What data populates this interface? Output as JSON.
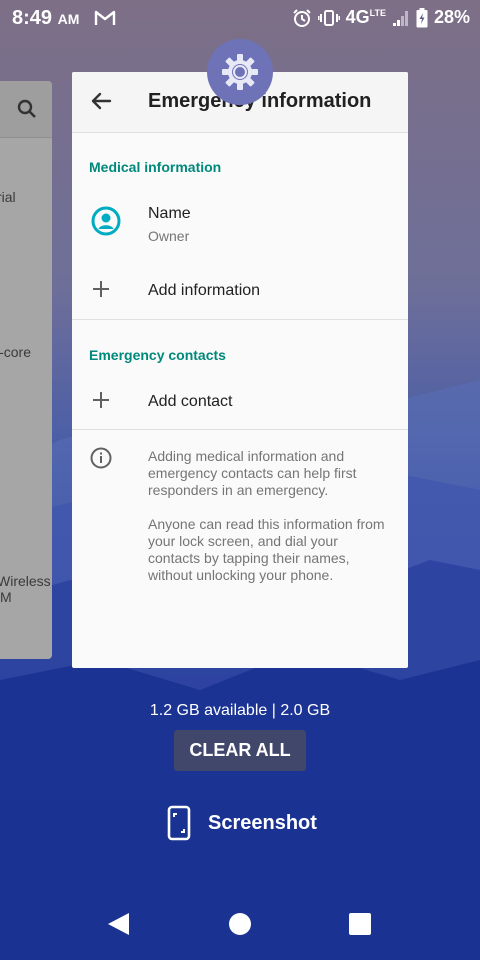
{
  "status_bar": {
    "time": "8:49",
    "ampm": "AM",
    "network": "4G",
    "network_sub": "LTE",
    "battery": "28%",
    "icons": [
      "gmail-icon",
      "alarm-icon",
      "vibrate-icon",
      "signal-icon",
      "battery-icon"
    ]
  },
  "left_card": {
    "texts": [
      "rial",
      "l-core",
      "Wireless",
      "M"
    ],
    "icons": [
      "search-icon"
    ]
  },
  "app_card": {
    "title": "Emergency information",
    "icon": "settings-gear-icon",
    "medical": {
      "heading": "Medical information",
      "name_label": "Name",
      "name_value": "Owner",
      "add_label": "Add information"
    },
    "contacts": {
      "heading": "Emergency contacts",
      "add_label": "Add contact"
    },
    "info": {
      "para1": "Adding medical information and emergency contacts can help first responders in an emergency.",
      "para2": "Anyone can read this information from your lock screen, and dial your contacts by tapping their names, without unlocking your phone."
    }
  },
  "recents": {
    "memory": "1.2 GB available | 2.0 GB",
    "clear_all": "CLEAR ALL",
    "screenshot_label": "Screenshot"
  },
  "nav_bar": {
    "icons": [
      "back-icon",
      "home-icon",
      "recents-icon"
    ]
  },
  "colors": {
    "accent": "#00897b",
    "avatar": "#00acc1",
    "gear_bg": "#6e73b7"
  }
}
